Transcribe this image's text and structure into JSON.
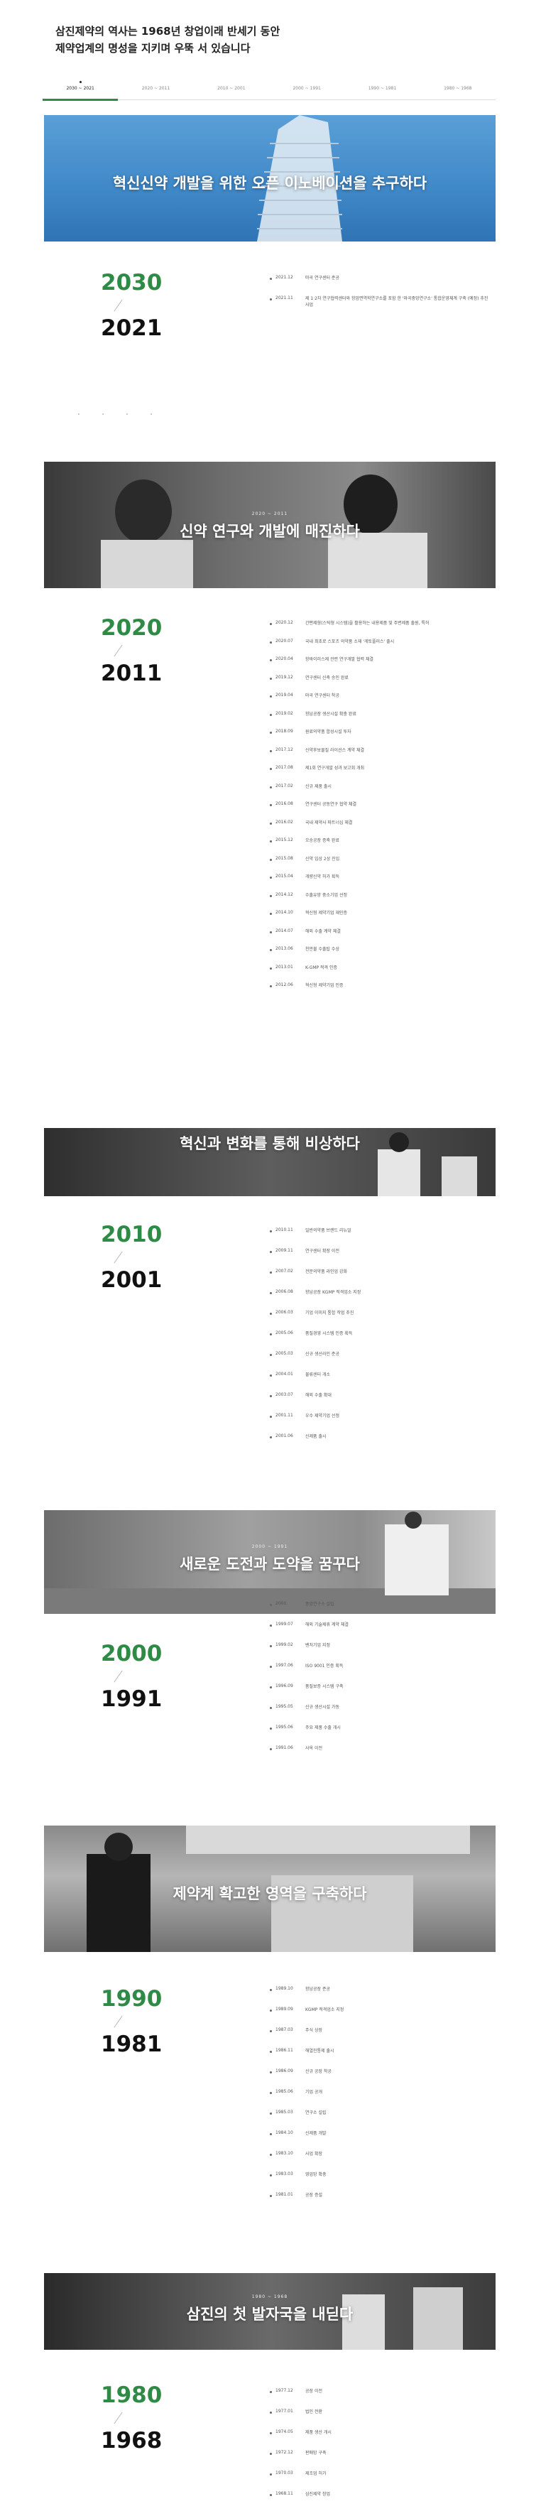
{
  "intro": {
    "line1": "삼진제약의 역사는 1968년 창업이래 반세기 동안",
    "line2": "제약업계의 명성을 지키며 우뚝 서 있습니다"
  },
  "tabs": [
    "2030 ~ 2021",
    "2020 ~ 2011",
    "2010 ~ 2001",
    "2000 ~ 1991",
    "1990 ~ 1981",
    "1980 ~ 1968"
  ],
  "colors": {
    "accent": "#2e8b45"
  },
  "sections": [
    {
      "banner_title": "혁신신약 개발을 위한 오픈 이노베이션을 추구하다",
      "banner_sub": "",
      "y1": "2030",
      "y2": "2021",
      "events": [
        {
          "d": "2021.12",
          "t": "마곡 연구센터 준공"
        },
        {
          "d": "2021.11",
          "t": "제 1·2차 연구협력센터와 항암면역학연구소를 포함 한 '마곡중앙연구소' 통합운영체계 구축 (예정) 추진 사업"
        }
      ]
    },
    {
      "banner_title": "신약 연구와 개발에 매진하다",
      "banner_sub": "2020 ~ 2011",
      "y1": "2020",
      "y2": "2011",
      "events": [
        {
          "d": "2020.12",
          "t": "간편제형(스틱형 시스템)을 활용하는 내용제품 및 주변제품 출원, 특허"
        },
        {
          "d": "2020.07",
          "t": "국내 최초로 스포츠 의약품 소재 '게토플러스' 출시"
        },
        {
          "d": "2020.04",
          "t": "항바이러스제 관련 연구개발 협력 체결"
        },
        {
          "d": "2019.12",
          "t": "연구센터 신축 승인 완료"
        },
        {
          "d": "2019.04",
          "t": "마곡 연구센터 착공"
        },
        {
          "d": "2019.02",
          "t": "향남공장 생산시설 확충 완료"
        },
        {
          "d": "2018.09",
          "t": "원료의약품 합성시설 투자"
        },
        {
          "d": "2017.12",
          "t": "신약후보물질 라이선스 계약 체결"
        },
        {
          "d": "2017.08",
          "t": "제1회 연구개발 성과 보고회 개최"
        },
        {
          "d": "2017.02",
          "t": "신규 제품 출시"
        },
        {
          "d": "2016.08",
          "t": "연구센터 공동연구 협약 체결"
        },
        {
          "d": "2016.02",
          "t": "국내 제약사 파트너십 체결"
        },
        {
          "d": "2015.12",
          "t": "오송공장 증축 완료"
        },
        {
          "d": "2015.08",
          "t": "신약 임상 2상 진입"
        },
        {
          "d": "2015.04",
          "t": "개량신약 허가 획득"
        },
        {
          "d": "2014.12",
          "t": "수출유망 중소기업 선정"
        },
        {
          "d": "2014.10",
          "t": "혁신형 제약기업 재인증"
        },
        {
          "d": "2014.07",
          "t": "해외 수출 계약 체결"
        },
        {
          "d": "2013.06",
          "t": "천만불 수출탑 수상"
        },
        {
          "d": "2013.01",
          "t": "K-GMP 적격 인증"
        },
        {
          "d": "2012.06",
          "t": "혁신형 제약기업 인증"
        }
      ]
    },
    {
      "banner_title": "혁신과 변화를 통해 비상하다",
      "banner_sub": "",
      "y1": "2010",
      "y2": "2001",
      "events": [
        {
          "d": "2010.11",
          "t": "일반의약품 브랜드 리뉴얼"
        },
        {
          "d": "2009.11",
          "t": "연구센터 확장 이전"
        },
        {
          "d": "2007.02",
          "t": "전문의약품 라인업 강화"
        },
        {
          "d": "2006.08",
          "t": "향남공장 KGMP 적격업소 지정"
        },
        {
          "d": "2006.03",
          "t": "기업 이미지 통합 작업 추진"
        },
        {
          "d": "2005.06",
          "t": "품질경영 시스템 인증 획득"
        },
        {
          "d": "2005.03",
          "t": "신규 생산라인 준공"
        },
        {
          "d": "2004.01",
          "t": "물류센터 개소"
        },
        {
          "d": "2003.07",
          "t": "해외 수출 확대"
        },
        {
          "d": "2001.11",
          "t": "우수 제약기업 선정"
        },
        {
          "d": "2001.06",
          "t": "신제품 출시"
        }
      ]
    },
    {
      "banner_title": "새로운 도전과 도약을 꿈꾸다",
      "banner_sub": "2000 ~ 1991",
      "y1": "2000",
      "y2": "1991",
      "events": [
        {
          "d": "2000.",
          "t": "중앙연구소 설립"
        },
        {
          "d": "1999.07",
          "t": "해외 기술제휴 계약 체결"
        },
        {
          "d": "1999.02",
          "t": "벤처기업 지정"
        },
        {
          "d": "1997.06",
          "t": "ISO 9001 인증 획득"
        },
        {
          "d": "1996.09",
          "t": "품질보증 시스템 구축"
        },
        {
          "d": "1995.05",
          "t": "신규 생산시설 가동"
        },
        {
          "d": "1995.06",
          "t": "주요 제품 수출 개시"
        },
        {
          "d": "1991.06",
          "t": "사옥 이전"
        }
      ]
    },
    {
      "banner_title": "제약계 확고한 영역을 구축하다",
      "banner_sub": "",
      "y1": "1990",
      "y2": "1981",
      "events": [
        {
          "d": "1989.10",
          "t": "향남공장 준공"
        },
        {
          "d": "1989.09",
          "t": "KGMP 적격업소 지정"
        },
        {
          "d": "1987.03",
          "t": "주식 상장"
        },
        {
          "d": "1986.11",
          "t": "해열진통제 출시"
        },
        {
          "d": "1986.09",
          "t": "신규 공장 착공"
        },
        {
          "d": "1985.06",
          "t": "기업 공개"
        },
        {
          "d": "1985.03",
          "t": "연구소 설립"
        },
        {
          "d": "1984.10",
          "t": "신제품 개발"
        },
        {
          "d": "1983.10",
          "t": "사업 확장"
        },
        {
          "d": "1983.03",
          "t": "영업망 확충"
        },
        {
          "d": "1981.01",
          "t": "공장 증설"
        }
      ]
    },
    {
      "banner_title": "삼진의 첫 발자국을 내딛다",
      "banner_sub": "1980 ~ 1968",
      "y1": "1980",
      "y2": "1968",
      "events": [
        {
          "d": "1977.12",
          "t": "공장 이전"
        },
        {
          "d": "1977.01",
          "t": "법인 전환"
        },
        {
          "d": "1974.05",
          "t": "제품 생산 개시"
        },
        {
          "d": "1972.12",
          "t": "판매망 구축"
        },
        {
          "d": "1970.03",
          "t": "제조업 허가"
        },
        {
          "d": "1968.11",
          "t": "삼진제약 창업"
        }
      ]
    }
  ]
}
